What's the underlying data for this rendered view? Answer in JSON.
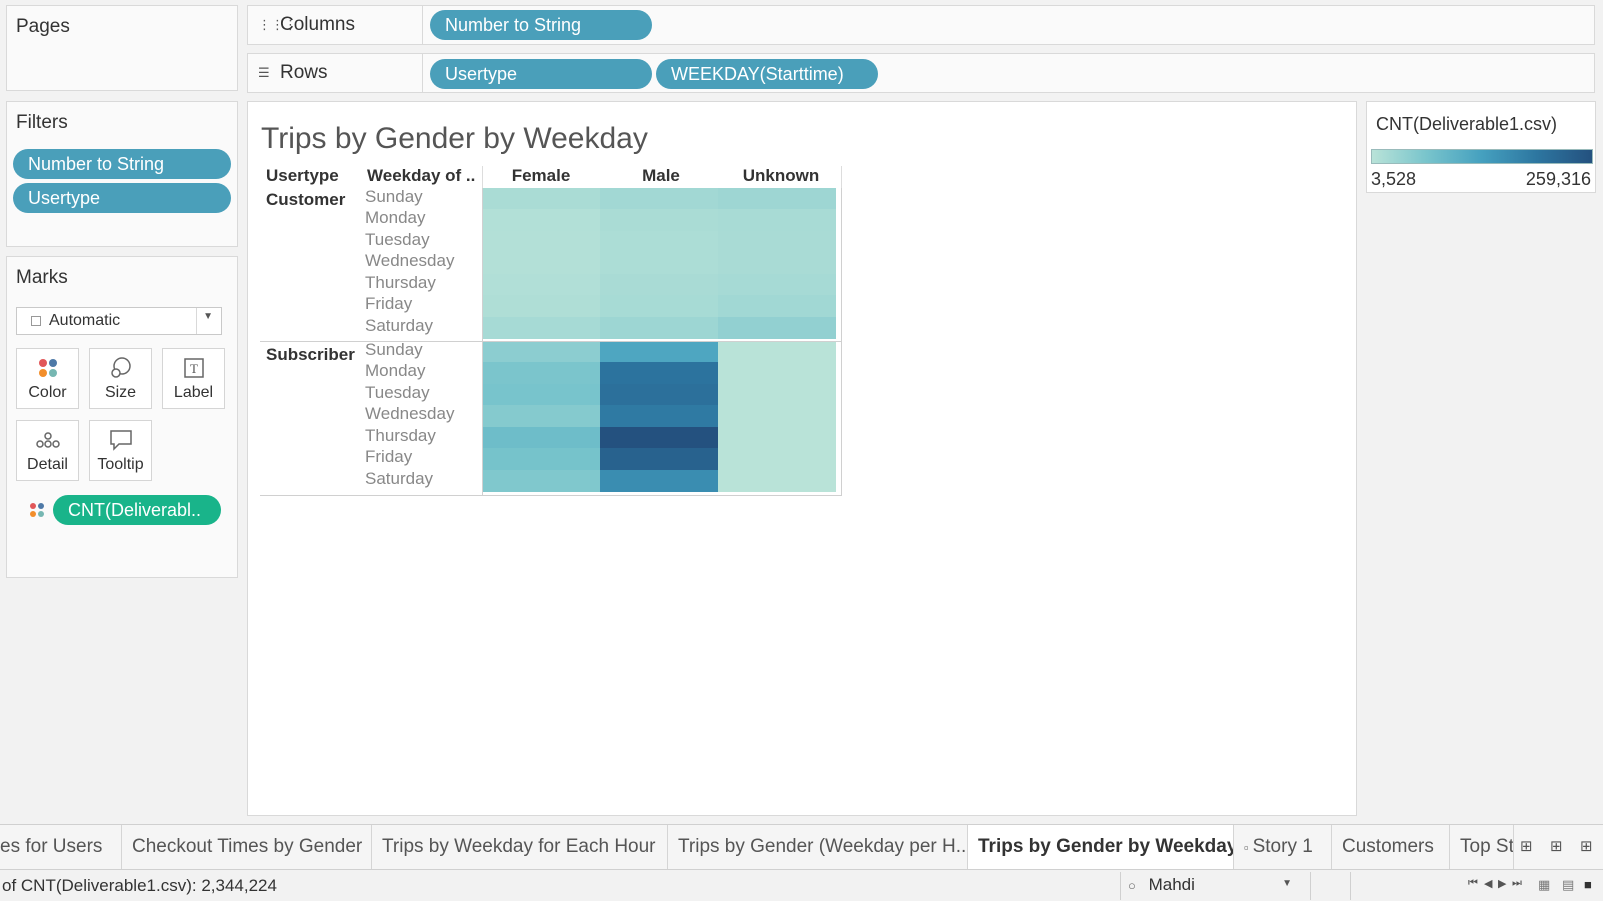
{
  "pages": {
    "title": "Pages"
  },
  "columns_shelf": {
    "label": "Columns",
    "icon": "columns-icon",
    "pills": [
      "Number to String"
    ]
  },
  "rows_shelf": {
    "label": "Rows",
    "icon": "rows-icon",
    "pills": [
      "Usertype",
      "WEEKDAY(Starttime)"
    ]
  },
  "filters": {
    "title": "Filters",
    "pills": [
      "Number to String",
      "Usertype"
    ]
  },
  "marks": {
    "title": "Marks",
    "type_dropdown": "Automatic",
    "buttons": {
      "color": "Color",
      "size": "Size",
      "label": "Label",
      "detail": "Detail",
      "tooltip": "Tooltip"
    },
    "field_pill": "CNT(Deliverabl.."
  },
  "viz": {
    "title": "Trips by Gender by Weekday",
    "headers": {
      "usertype": "Usertype",
      "weekday": "Weekday of ..",
      "female": "Female",
      "male": "Male",
      "unknown": "Unknown"
    },
    "weekdays": [
      "Sunday",
      "Monday",
      "Tuesday",
      "Wednesday",
      "Thursday",
      "Friday",
      "Saturday"
    ],
    "groups": [
      "Customer",
      "Subscriber"
    ]
  },
  "chart_data": {
    "type": "heatmap",
    "title": "Trips by Gender by Weekday",
    "measure": "CNT(Deliverable1.csv)",
    "columns": [
      "Female",
      "Male",
      "Unknown"
    ],
    "rows": [
      {
        "usertype": "Customer",
        "weekday": "Sunday",
        "values": [
          18000,
          26000,
          30000
        ]
      },
      {
        "usertype": "Customer",
        "weekday": "Monday",
        "values": [
          10000,
          18000,
          20000
        ]
      },
      {
        "usertype": "Customer",
        "weekday": "Tuesday",
        "values": [
          9000,
          16000,
          19000
        ]
      },
      {
        "usertype": "Customer",
        "weekday": "Wednesday",
        "values": [
          9500,
          16500,
          19500
        ]
      },
      {
        "usertype": "Customer",
        "weekday": "Thursday",
        "values": [
          11000,
          19000,
          22000
        ]
      },
      {
        "usertype": "Customer",
        "weekday": "Friday",
        "values": [
          13000,
          21000,
          27000
        ]
      },
      {
        "usertype": "Customer",
        "weekday": "Saturday",
        "values": [
          22000,
          31000,
          42000
        ]
      },
      {
        "usertype": "Subscriber",
        "weekday": "Sunday",
        "values": [
          48000,
          120000,
          4000
        ]
      },
      {
        "usertype": "Subscriber",
        "weekday": "Monday",
        "values": [
          65000,
          200000,
          3800
        ]
      },
      {
        "usertype": "Subscriber",
        "weekday": "Tuesday",
        "values": [
          68000,
          205000,
          3600
        ]
      },
      {
        "usertype": "Subscriber",
        "weekday": "Wednesday",
        "values": [
          55000,
          190000,
          3600
        ]
      },
      {
        "usertype": "Subscriber",
        "weekday": "Thursday",
        "values": [
          80000,
          259316,
          3528
        ]
      },
      {
        "usertype": "Subscriber",
        "weekday": "Friday",
        "values": [
          70000,
          230000,
          3700
        ]
      },
      {
        "usertype": "Subscriber",
        "weekday": "Saturday",
        "values": [
          60000,
          160000,
          3900
        ]
      }
    ],
    "color_range": [
      3528,
      259316
    ],
    "colors": {
      "low": "#b9e3d8",
      "high": "#24517f"
    },
    "legend_position": "right"
  },
  "legend": {
    "title": "CNT(Deliverable1.csv)",
    "min_label": "3,528",
    "max_label": "259,316"
  },
  "tabs": [
    {
      "label": "es for Users",
      "active": false
    },
    {
      "label": "Checkout Times by Gender",
      "active": false
    },
    {
      "label": "Trips by Weekday for Each Hour",
      "active": false
    },
    {
      "label": "Trips by Gender (Weekday per H...",
      "active": false
    },
    {
      "label": "Trips by Gender by Weekday",
      "active": true
    },
    {
      "label": "Story 1",
      "active": false
    },
    {
      "label": "Customers",
      "active": false
    },
    {
      "label": "Top St",
      "active": false
    }
  ],
  "status": {
    "summary": "of CNT(Deliverable1.csv): 2,344,224",
    "user": "Mahdi"
  }
}
